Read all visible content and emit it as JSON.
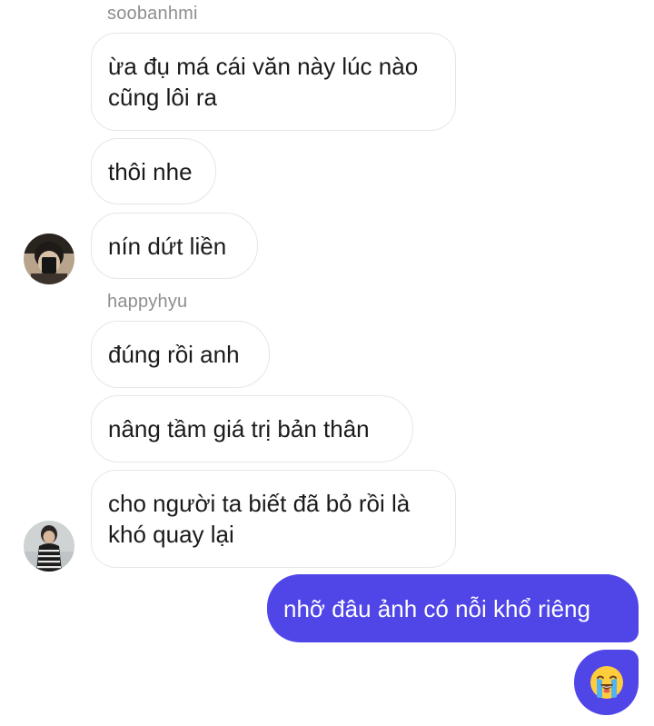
{
  "conversation": {
    "group1": {
      "sender": "soobanhmi",
      "messages": [
        "ừa đụ má cái văn này lúc nào cũng lôi ra",
        "thôi nhe",
        "nín dứt liền"
      ]
    },
    "group2": {
      "sender": "happyhyu",
      "messages": [
        "đúng rồi anh",
        "nâng tầm giá trị bản thân",
        "cho người ta biết đã bỏ rồi là khó quay lại"
      ]
    },
    "outgoing": {
      "messages": [
        "nhỡ đâu ảnh có nỗi khổ riêng"
      ],
      "reaction_icon": "loudly-crying-face-emoji"
    }
  },
  "colors": {
    "outgoing_bubble": "#5046e8",
    "incoming_border": "#e6e6e6",
    "sender_name": "#8e8e8e"
  }
}
